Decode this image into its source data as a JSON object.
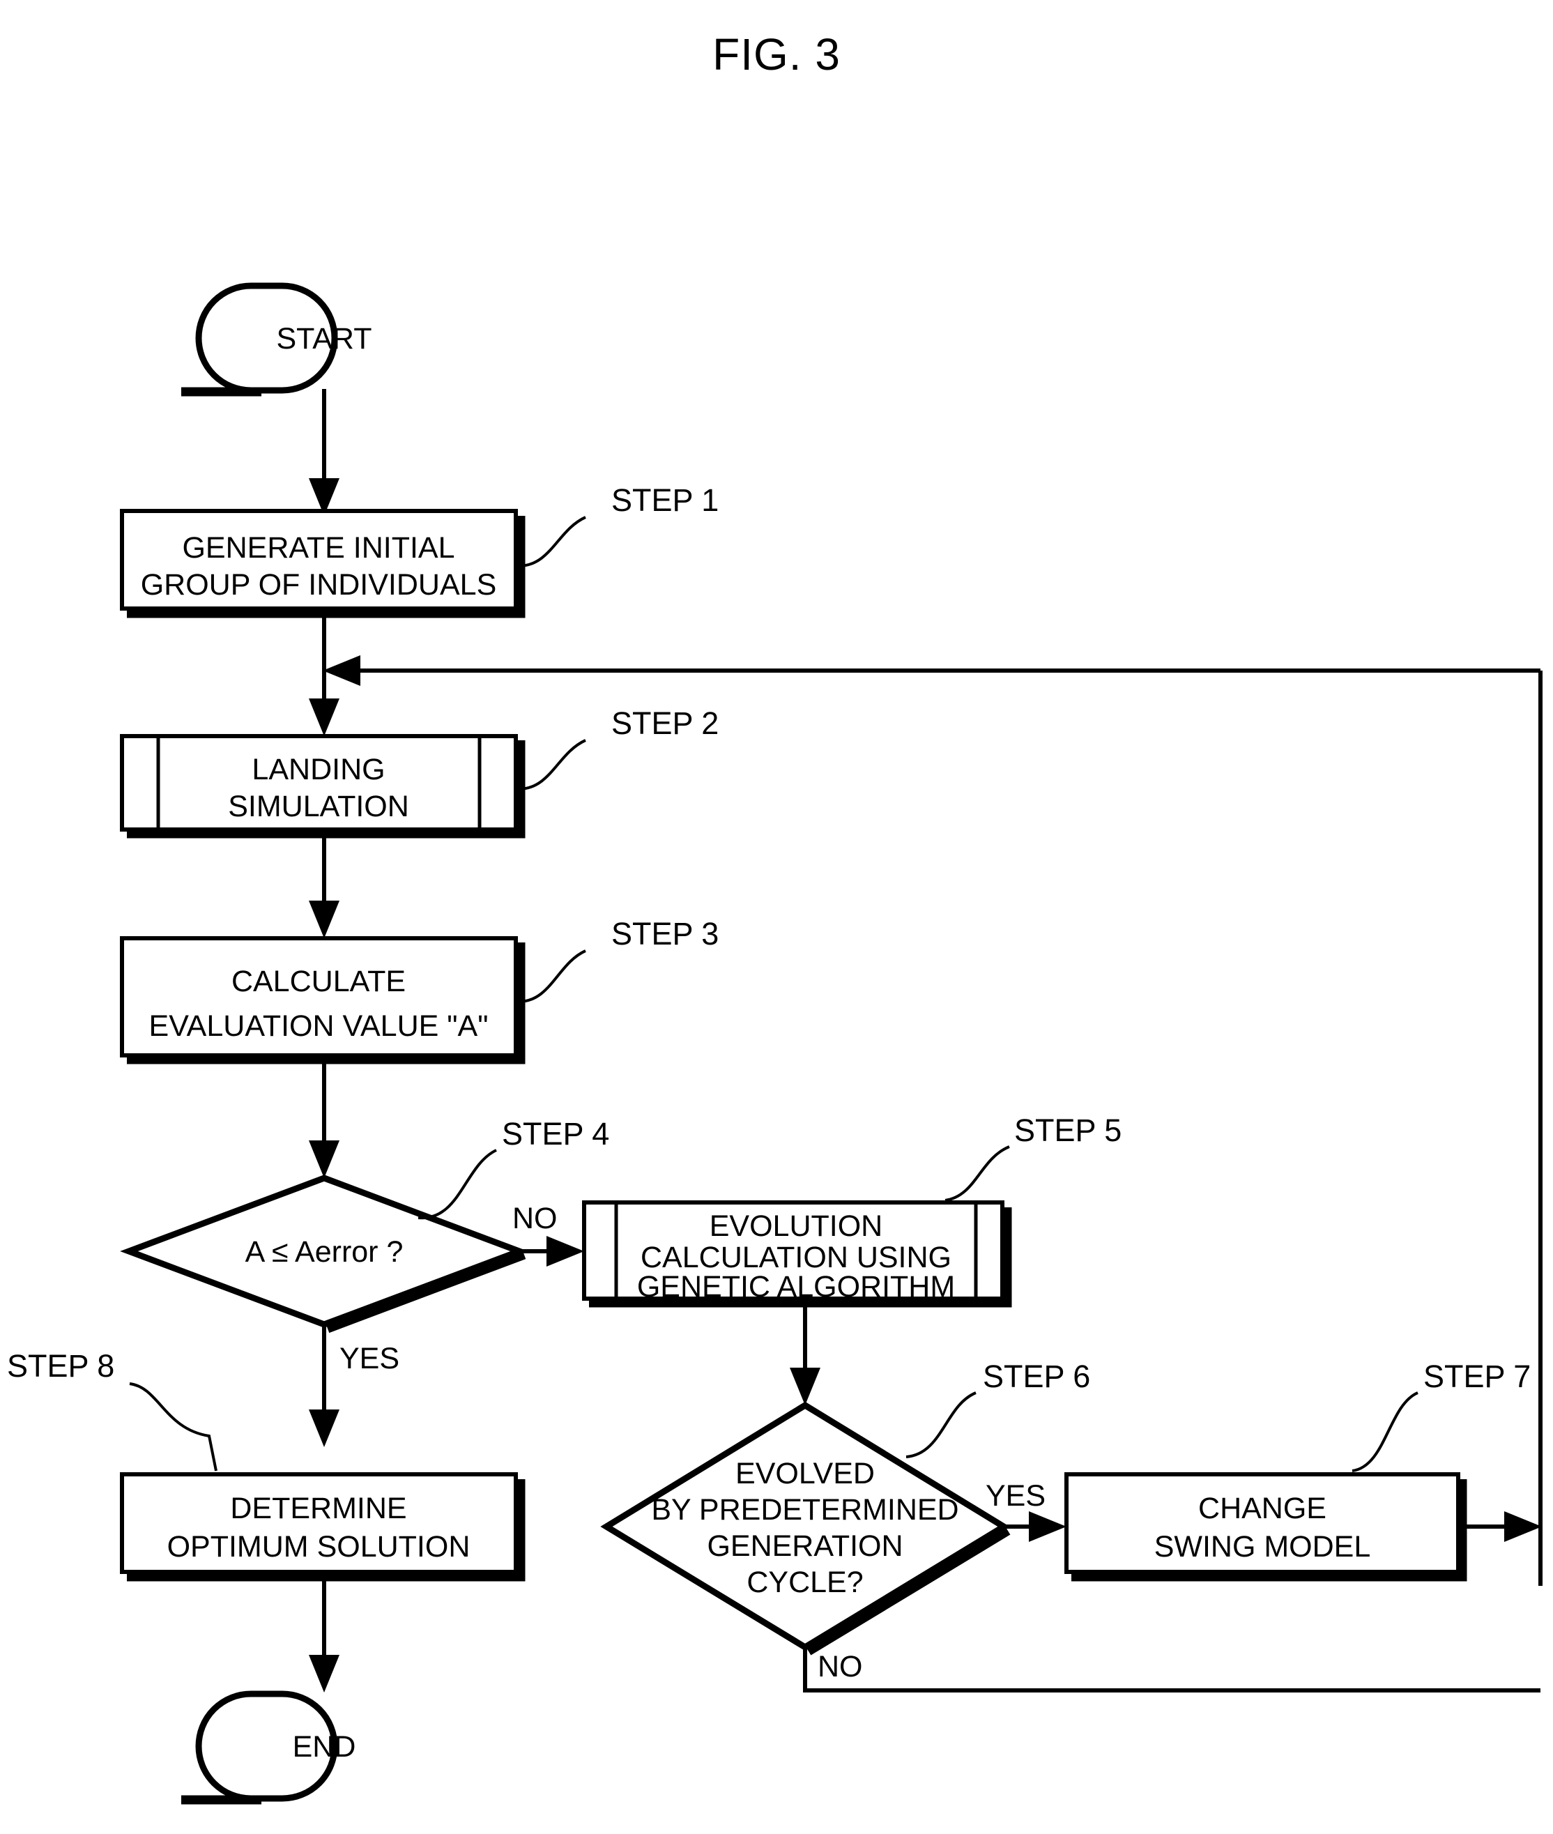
{
  "figure": {
    "title": "FIG. 3",
    "type": "flowchart"
  },
  "nodes": {
    "start": {
      "label": "START",
      "shape": "terminator"
    },
    "end": {
      "label": "END",
      "shape": "terminator"
    },
    "step1": {
      "shape": "process",
      "line1": "GENERATE INITIAL",
      "line2": "GROUP OF INDIVIDUALS"
    },
    "step2": {
      "shape": "predefined-process",
      "line1": "LANDING",
      "line2": "SIMULATION"
    },
    "step3": {
      "shape": "process",
      "line1": "CALCULATE",
      "line2": "EVALUATION VALUE \"A\""
    },
    "step4": {
      "shape": "decision",
      "line1": "A ≤ Aerror ?"
    },
    "step5": {
      "shape": "predefined-process",
      "line1": "EVOLUTION",
      "line2": "CALCULATION USING",
      "line3": "GENETIC ALGORITHM"
    },
    "step6": {
      "shape": "decision",
      "line1": "EVOLVED",
      "line2": "BY PREDETERMINED",
      "line3": "GENERATION",
      "line4": "CYCLE?"
    },
    "step7": {
      "shape": "process",
      "line1": "CHANGE",
      "line2": "SWING MODEL"
    },
    "step8": {
      "shape": "process",
      "line1": "DETERMINE",
      "line2": "OPTIMUM SOLUTION"
    }
  },
  "step_callouts": {
    "step1": "STEP 1",
    "step2": "STEP 2",
    "step3": "STEP 3",
    "step4": "STEP 4",
    "step5": "STEP 5",
    "step6": "STEP 6",
    "step7": "STEP 7",
    "step8": "STEP 8"
  },
  "branch_labels": {
    "step4_no": "NO",
    "step4_yes": "YES",
    "step6_yes": "YES",
    "step6_no": "NO"
  },
  "colors": {
    "ink": "#000000",
    "paper": "#ffffff"
  }
}
